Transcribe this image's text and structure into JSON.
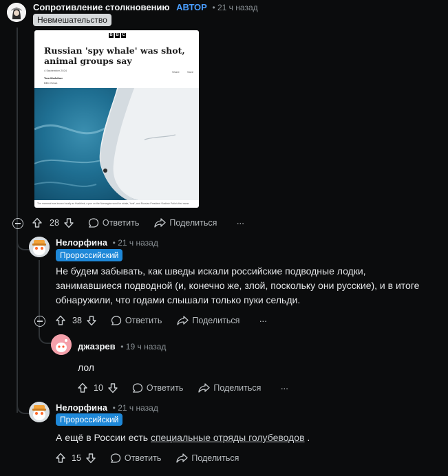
{
  "comments": {
    "c1": {
      "username": "Сопротивление столкновению",
      "author_tag": "АВТОР",
      "time": "• 21 ч назад",
      "flair": "Невмешательство",
      "votes": "28",
      "reply_label": "Ответить",
      "share_label": "Поделиться",
      "more_label": "···",
      "article": {
        "logo": [
          "B",
          "B",
          "C"
        ],
        "headline": "Russian 'spy whale' was shot, animal groups say",
        "date": "4 September 2024",
        "byline": "Tom McArthur",
        "byline_org": "BBC News",
        "share": "Share",
        "save": "Save",
        "caption": "The mammal was known locally as Hvaldimir, a pun on the Norwegian word for whale, 'hval', and Russian President Vladimir Putin's first name"
      }
    },
    "c2": {
      "username": "Нелорфина",
      "time": "• 21 ч назад",
      "flair": "Пророссийский",
      "body": "Не будем забывать, как шведы искали российские подводные лодки, занимавшиеся подводной (и, конечно же, злой, поскольку они русские), и в итоге обнаружили, что годами слышали только пуки сельди.",
      "votes": "38",
      "reply_label": "Ответить",
      "share_label": "Поделиться",
      "more_label": "···"
    },
    "c3": {
      "username": "джазрев",
      "time": "• 19 ч назад",
      "body": "лол",
      "votes": "10",
      "reply_label": "Ответить",
      "share_label": "Поделиться",
      "more_label": "···"
    },
    "c4": {
      "username": "Нелорфина",
      "time": "• 21 ч назад",
      "flair": "Пророссийский",
      "body_prefix": "А ещё в России есть ",
      "body_link": "специальные отряды голубеводов",
      "body_suffix": " .",
      "votes": "15",
      "reply_label": "Ответить",
      "share_label": "Поделиться"
    }
  },
  "colors": {
    "background": "#0b0c0d",
    "author_accent": "#4a9eff",
    "flair_blue": "#1e88d8",
    "flair_grey": "#d6d9db"
  }
}
